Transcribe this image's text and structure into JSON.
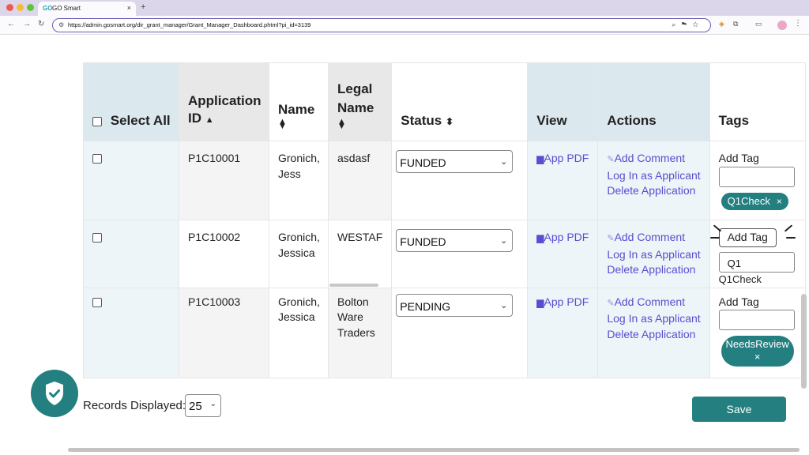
{
  "browser": {
    "tab_title": "GO Smart",
    "favicon": "GO",
    "tab_close": "×",
    "new_tab": "+",
    "url": "https://admin.gosmart.org/dir_grant_manager/Grant_Manager_Dashboard.phtml?pi_id=3139"
  },
  "table": {
    "headers": {
      "select_all": "Select All",
      "application_id": "Application ID",
      "name": "Name",
      "legal_name": "Legal Name",
      "status": "Status",
      "view": "View",
      "actions": "Actions",
      "tags": "Tags"
    },
    "rows": [
      {
        "application_id": "P1C10001",
        "name": "Gronich, Jess",
        "legal_name": "asdasf",
        "status": "FUNDED",
        "view_label": "App PDF",
        "actions": [
          "Add Comment",
          "Log In as Applicant",
          "Delete Application"
        ],
        "tag_label": "Add Tag",
        "tag_input": "",
        "chips": [
          "Q1Check"
        ]
      },
      {
        "application_id": "P1C10002",
        "name": "Gronich, Jessica",
        "legal_name": "WESTAF",
        "status": "FUNDED",
        "view_label": "App PDF",
        "actions": [
          "Add Comment",
          "Log In as Applicant",
          "Delete Application"
        ],
        "tag_label": "Add Tag",
        "tag_input": "Q1",
        "suggestion": "Q1Check"
      },
      {
        "application_id": "P1C10003",
        "name": "Gronich, Jessica",
        "legal_name": "Bolton Ware Traders",
        "status": "PENDING",
        "view_label": "App PDF",
        "actions": [
          "Add Comment",
          "Log In as Applicant",
          "Delete Application"
        ],
        "tag_label": "Add Tag",
        "tag_input": "",
        "chips": [
          "NeedsReview"
        ]
      }
    ],
    "chip_close": "×"
  },
  "footer": {
    "records_label": "Records Displayed:",
    "records_value": "25",
    "save_label": "Save"
  },
  "colors": {
    "accent": "#237f80",
    "link": "#5b4cd0",
    "header_blue": "#dbe9ef"
  }
}
